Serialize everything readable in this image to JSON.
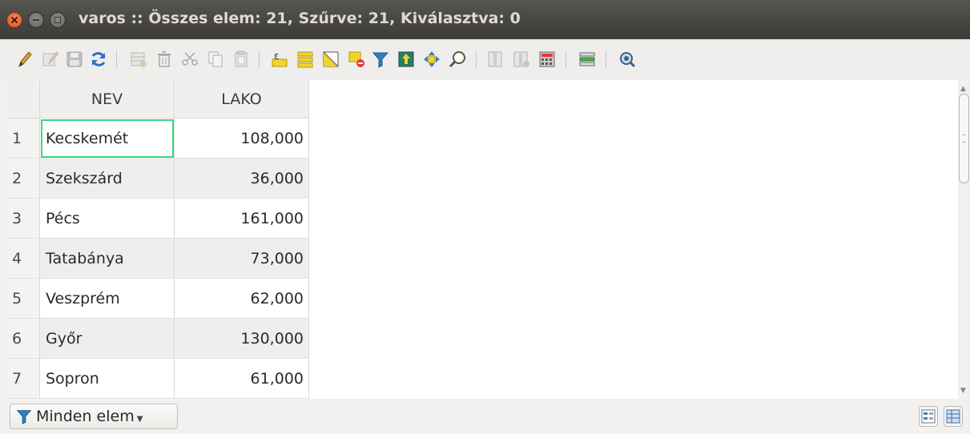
{
  "window": {
    "title": "varos :: Összes elem: 21, Szűrve: 21, Kiválasztva: 0"
  },
  "toolbar": {
    "buttons": [
      {
        "icon": "pencil-icon",
        "enabled": true
      },
      {
        "icon": "multi-edit-icon",
        "enabled": false
      },
      {
        "icon": "save-icon",
        "enabled": false
      },
      {
        "icon": "reload-icon",
        "enabled": true
      },
      {
        "icon": "add-feature-icon",
        "enabled": false
      },
      {
        "icon": "delete-icon",
        "enabled": false
      },
      {
        "icon": "cut-icon",
        "enabled": false
      },
      {
        "icon": "copy-icon",
        "enabled": false
      },
      {
        "icon": "paste-icon",
        "enabled": false
      },
      {
        "icon": "select-by-expression-icon",
        "enabled": true
      },
      {
        "icon": "select-all-icon",
        "enabled": true
      },
      {
        "icon": "invert-selection-icon",
        "enabled": true
      },
      {
        "icon": "deselect-icon",
        "enabled": true
      },
      {
        "icon": "filter-icon",
        "enabled": true
      },
      {
        "icon": "move-selection-to-top-icon",
        "enabled": true
      },
      {
        "icon": "pan-to-selection-icon",
        "enabled": true
      },
      {
        "icon": "zoom-to-selection-icon",
        "enabled": true
      },
      {
        "icon": "new-field-icon",
        "enabled": false
      },
      {
        "icon": "delete-field-icon",
        "enabled": false
      },
      {
        "icon": "field-calculator-icon",
        "enabled": true
      },
      {
        "icon": "conditional-formatting-icon",
        "enabled": true
      },
      {
        "icon": "actions-icon",
        "enabled": true
      }
    ]
  },
  "table": {
    "columns": [
      "NEV",
      "LAKO"
    ],
    "rows": [
      {
        "id": "1",
        "nev": "Kecskemét",
        "lako": "108,000"
      },
      {
        "id": "2",
        "nev": "Szekszárd",
        "lako": "36,000"
      },
      {
        "id": "3",
        "nev": "Pécs",
        "lako": "161,000"
      },
      {
        "id": "4",
        "nev": "Tatabánya",
        "lako": "73,000"
      },
      {
        "id": "5",
        "nev": "Veszprém",
        "lako": "62,000"
      },
      {
        "id": "6",
        "nev": "Győr",
        "lako": "130,000"
      },
      {
        "id": "7",
        "nev": "Sopron",
        "lako": "61,000"
      }
    ],
    "focused_cell": {
      "row": 1,
      "column": "NEV"
    }
  },
  "bottom_bar": {
    "filter_label": "Minden elem"
  },
  "colors": {
    "titlebar": "#3c3b37",
    "close_button": "#df4b16",
    "focus_outline": "#3ed48a",
    "alt_row": "#efeeec"
  }
}
